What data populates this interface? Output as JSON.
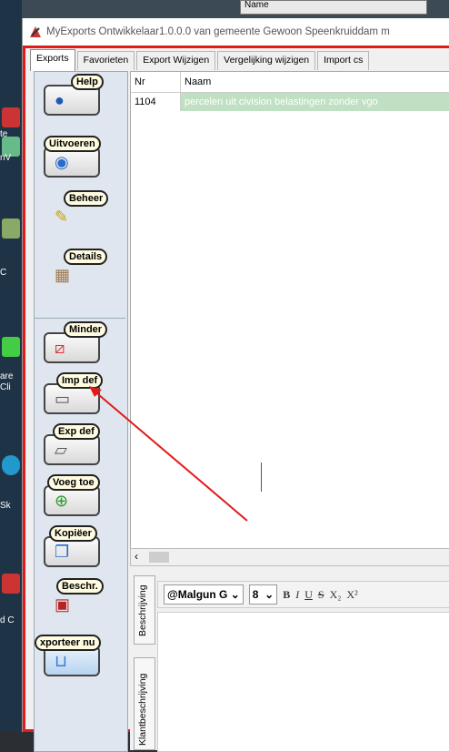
{
  "window": {
    "title": "MyExports Ontwikkelaar1.0.0.0  van gemeente Gewoon Speenkruiddam m"
  },
  "background_window": {
    "label": "Name"
  },
  "desktop": {
    "labels": [
      "te",
      "nV",
      "C",
      "are",
      "Cli",
      "Sk",
      "d C"
    ]
  },
  "tabs": [
    {
      "label": "Exports",
      "active": true
    },
    {
      "label": "Favorieten",
      "active": false
    },
    {
      "label": "Export Wijzigen",
      "active": false
    },
    {
      "label": "Vergelijking wijzigen",
      "active": false
    },
    {
      "label": "Import cs",
      "active": false
    }
  ],
  "left_buttons": [
    {
      "label": "Help",
      "icon": "help-icon"
    },
    {
      "label": "Uitvoeren",
      "icon": "run-icon"
    },
    {
      "label": "Beheer",
      "icon": "pencil-icon"
    },
    {
      "label": "Details",
      "icon": "details-icon"
    },
    {
      "label": "Minder",
      "icon": "eraser-icon"
    },
    {
      "label": "Imp def",
      "icon": "import-definition-icon"
    },
    {
      "label": "Exp def",
      "icon": "export-definition-icon"
    },
    {
      "label": "Voeg toe",
      "icon": "add-icon"
    },
    {
      "label": "Kopiëer",
      "icon": "copy-icon"
    },
    {
      "label": "Beschr.",
      "icon": "abc-book-icon"
    },
    {
      "label": "xporteer nu",
      "icon": "tray-icon"
    }
  ],
  "grid": {
    "columns": [
      "Nr",
      "Naam"
    ],
    "rows": [
      {
        "nr": "1104",
        "naam": "percelen uit civision belastingen zonder vgo"
      }
    ]
  },
  "editor": {
    "side_tabs": [
      "Beschrijving",
      "Klantbeschrijving"
    ],
    "font_name": "@Malgun G",
    "font_size": "8",
    "format_buttons": [
      "B",
      "I",
      "U",
      "S",
      "X₂",
      "X²"
    ]
  },
  "colors": {
    "frame_red": "#e11b1b",
    "selected_row": "#bfe0c2",
    "panel_blue": "#dfe6ef"
  }
}
